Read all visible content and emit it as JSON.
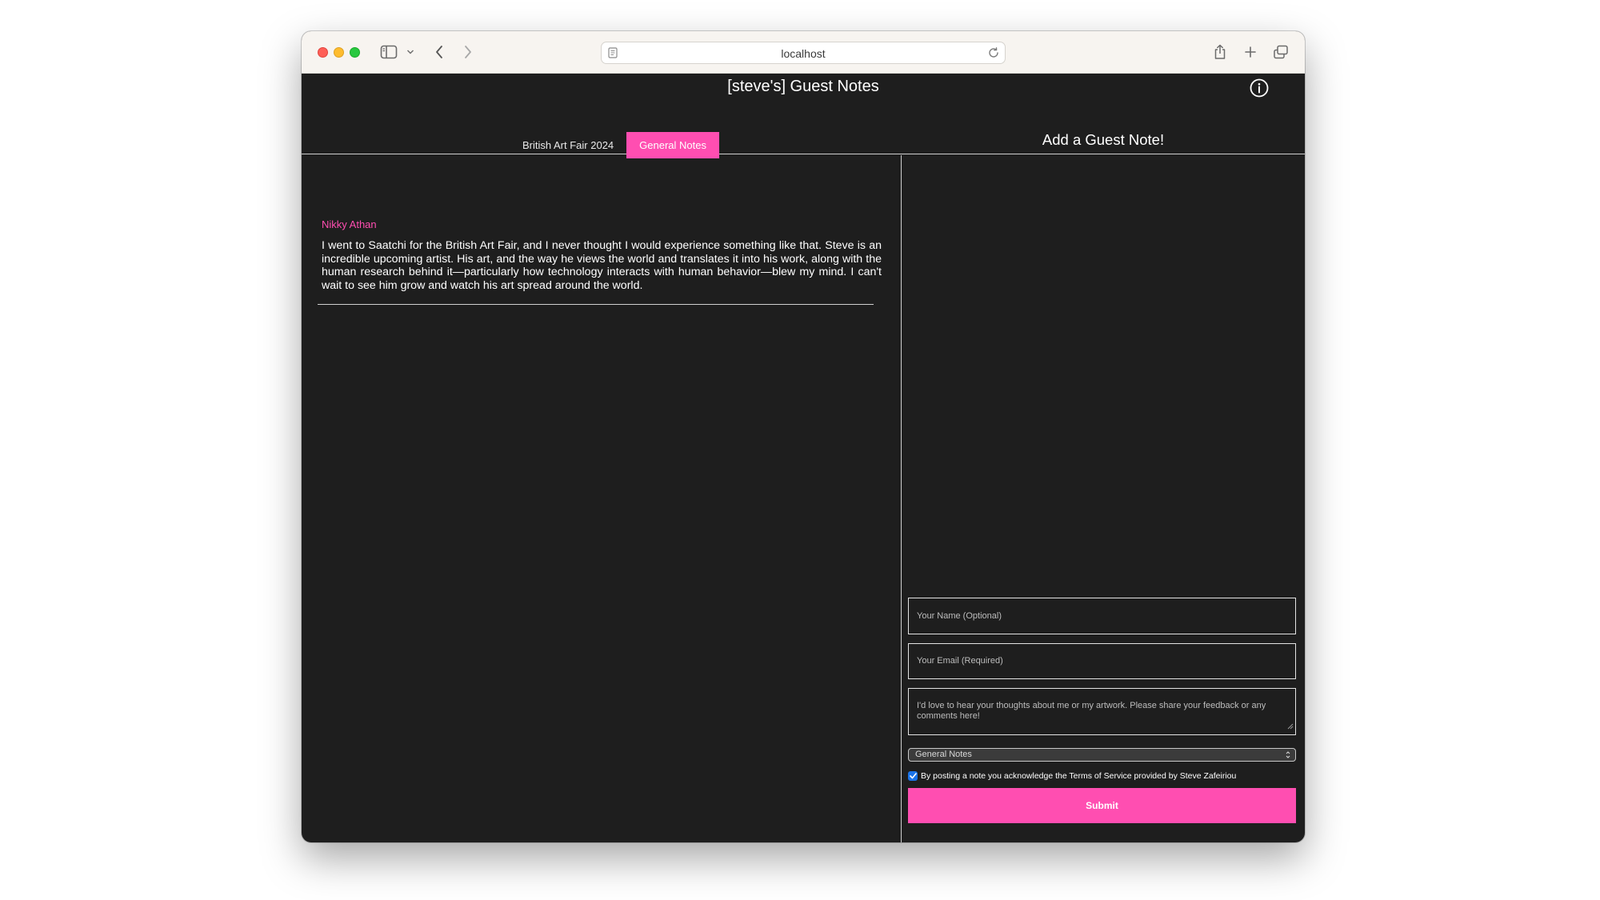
{
  "browser": {
    "url": "localhost"
  },
  "app": {
    "title": "[steve's] Guest Notes"
  },
  "tabs": [
    {
      "label": "British Art Fair 2024",
      "active": false
    },
    {
      "label": "General Notes",
      "active": true
    }
  ],
  "notes": [
    {
      "author": "Nikky Athan",
      "text": "I went to Saatchi for the British Art Fair, and I never thought I would experience something like that. Steve is an incredible upcoming artist. His art, and the way he views the world and translates it into his work, along with the human research behind it—particularly how technology interacts with human behavior—blew my mind. I can't wait to see him grow and watch his art spread around the world."
    }
  ],
  "form": {
    "title": "Add a Guest Note!",
    "name_placeholder": "Your Name (Optional)",
    "email_placeholder": "Your Email (Required)",
    "message_placeholder": "I'd love to hear your thoughts about me or my artwork. Please share your feedback or any comments here!",
    "category_selected": "General Notes",
    "tos_label": "By posting a note you acknowledge the Terms of Service provided by Steve Zafeiriou",
    "tos_checked": true,
    "submit_label": "Submit"
  },
  "colors": {
    "accent": "#ff4eb1",
    "background": "#1e1e1e",
    "toolbar": "#f7f4f0"
  }
}
